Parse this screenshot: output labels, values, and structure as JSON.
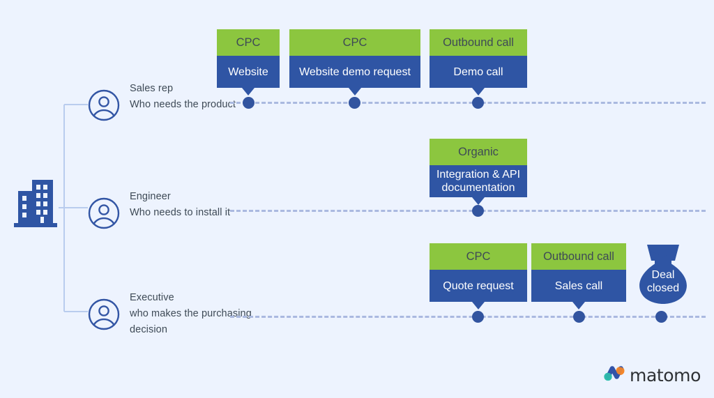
{
  "theme": {
    "background": "#edf3fe",
    "green": "#8cc63f",
    "blue": "#2f55a4",
    "dot_blue": "#32549f",
    "dash_blue": "#aab9e0",
    "text_dark": "#3e4a56",
    "logo_teal": "#2fbdad",
    "logo_green": "#3bc47c",
    "logo_blue": "#3253a8",
    "logo_orange": "#f4872a"
  },
  "org": {
    "icon": "office-building-icon"
  },
  "personas": [
    {
      "title": "Sales rep",
      "description": "Who needs the product",
      "icon": "user-avatar-icon"
    },
    {
      "title": "Engineer",
      "description": "Who needs to install it",
      "icon": "user-avatar-icon"
    },
    {
      "title": "Executive",
      "description": "who makes the purchasing decision",
      "icon": "user-avatar-icon"
    }
  ],
  "journeys": [
    {
      "persona": "Sales rep",
      "steps": [
        {
          "channel": "CPC",
          "touchpoint": "Website"
        },
        {
          "channel": "CPC",
          "touchpoint": "Website demo request"
        },
        {
          "channel": "Outbound call",
          "touchpoint": "Demo call"
        }
      ]
    },
    {
      "persona": "Engineer",
      "steps": [
        {
          "channel": "Organic",
          "touchpoint": "Integration & API documentation"
        }
      ]
    },
    {
      "persona": "Executive",
      "steps": [
        {
          "channel": "CPC",
          "touchpoint": "Quote request"
        },
        {
          "channel": "Outbound call",
          "touchpoint": "Sales call"
        }
      ]
    }
  ],
  "outcome": {
    "label": "Deal closed",
    "line1": "Deal",
    "line2": "closed",
    "icon": "money-bag-icon"
  },
  "brand": {
    "name": "matomo",
    "icon": "matomo-logo-icon"
  }
}
